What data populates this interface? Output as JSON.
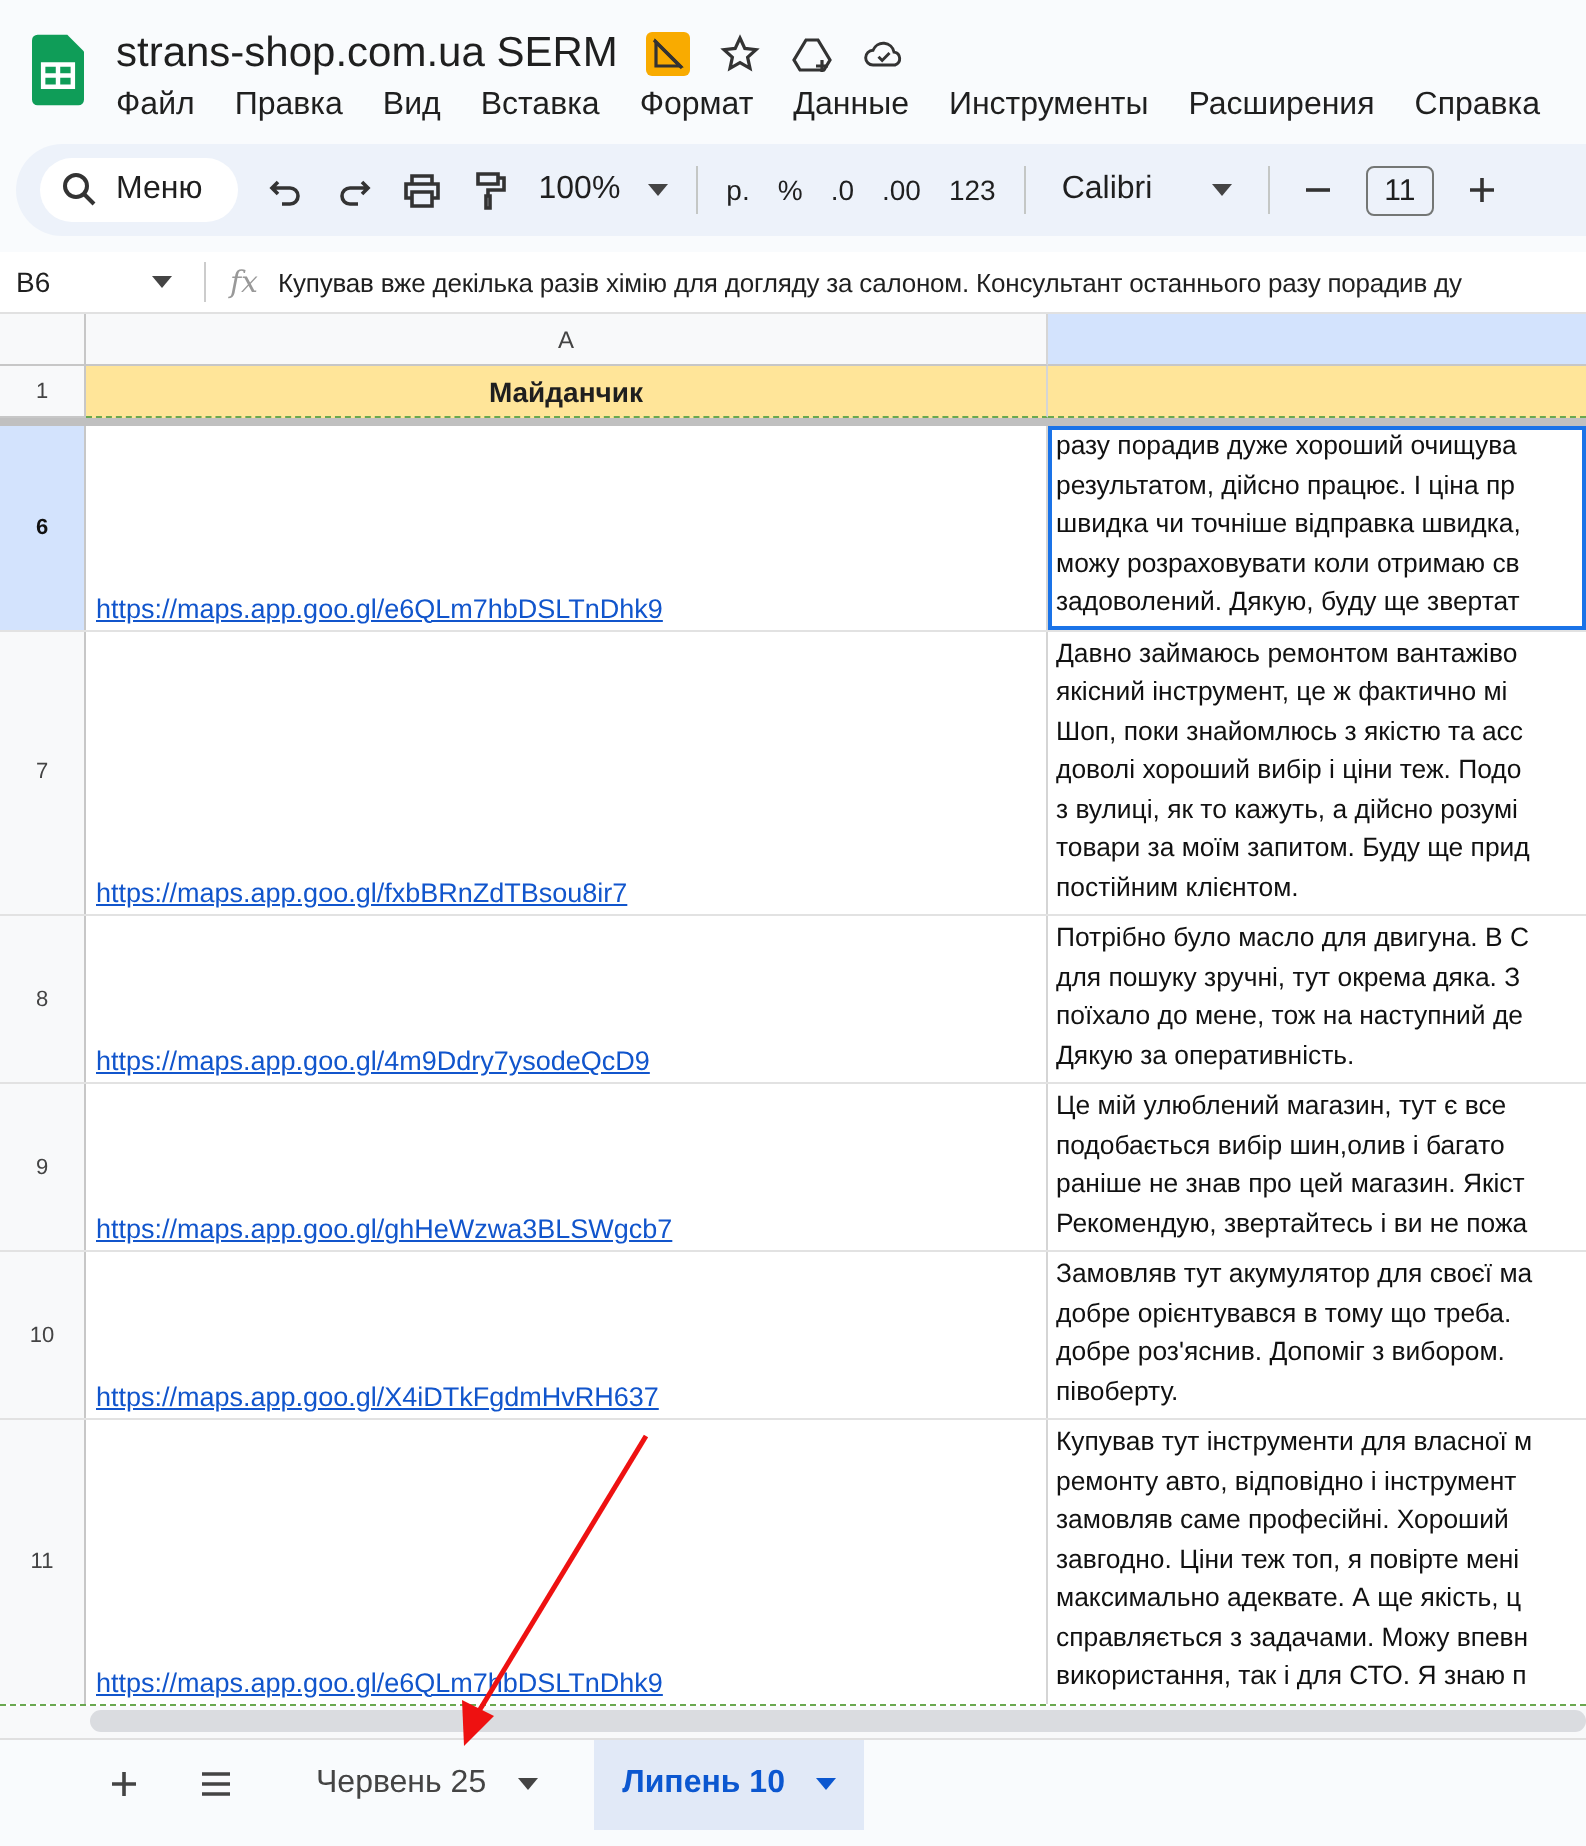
{
  "app": {
    "title": "strans-shop.com.ua SERM",
    "menu": [
      "Файл",
      "Правка",
      "Вид",
      "Вставка",
      "Формат",
      "Данные",
      "Инструменты",
      "Расширения",
      "Справка"
    ]
  },
  "toolbar": {
    "menu_search": "Меню",
    "zoom": "100%",
    "formats": [
      "р.",
      "%",
      ".0",
      ".00",
      "123"
    ],
    "font": "Calibri",
    "font_size": "11"
  },
  "formula_bar": {
    "cell": "B6",
    "function_label": "fx",
    "content": "Купував вже декілька разів хімію для догляду за салоном. Консультант останнього разу порадив ду"
  },
  "columns": [
    {
      "label": "A",
      "selected": false
    },
    {
      "selected": true
    }
  ],
  "header_row": {
    "number": "1",
    "title": "Майданчик"
  },
  "rows": [
    {
      "number": "6",
      "selected": true,
      "link": "https://maps.app.goo.gl/e6QLm7hbDSLTnDhk9",
      "review": [
        "разу порадив дуже хороший очищува",
        "результатом, дійсно працює. І ціна пр",
        "швидка чи точніше відправка швидка,",
        "можу розраховувати коли отримаю св",
        "задоволений. Дякую, буду ще звертат"
      ]
    },
    {
      "number": "7",
      "selected": false,
      "link": "https://maps.app.goo.gl/fxbBRnZdTBsou8ir7",
      "review": [
        "Давно займаюсь ремонтом вантажіво",
        "якісний інструмент, це ж фактично мі",
        "Шоп, поки знайомлюсь з якістю та асс",
        "доволі хороший вибір і ціни теж. Подо",
        "з вулиці, як то кажуть, а дійсно розумі",
        "товари за моїм запитом. Буду ще прид",
        "постійним клієнтом."
      ]
    },
    {
      "number": "8",
      "selected": false,
      "link": "https://maps.app.goo.gl/4m9Ddry7ysodeQcD9",
      "review": [
        "Потрібно було масло для двигуна. В С",
        "для пошуку зручні, тут окрема дяка. З",
        "поїхало до мене, тож на наступний де",
        "Дякую за оперативність."
      ]
    },
    {
      "number": "9",
      "selected": false,
      "link": "https://maps.app.goo.gl/ghHeWzwa3BLSWgcb7",
      "review": [
        "Це мій улюблений магазин, тут є все",
        "подобається вибір шин,олив і багато",
        "раніше не знав про цей магазин. Якіст",
        "Рекомендую, звертайтесь і ви не пожа"
      ]
    },
    {
      "number": "10",
      "selected": false,
      "link": "https://maps.app.goo.gl/X4iDTkFgdmHvRH637",
      "review": [
        "Замовляв тут акумулятор для своєї ма",
        "добре орієнтувався в тому що треба.",
        "добре роз'яснив. Допоміг з вибором.",
        "півоберту."
      ]
    },
    {
      "number": "11",
      "selected": false,
      "link": "https://maps.app.goo.gl/e6QLm7hbDSLTnDhk9",
      "review": [
        "Купував тут інструменти для власної м",
        "ремонту авто, відповідно і інструмент",
        "замовляв саме професійні. Хороший",
        "завгодно. Ціни теж топ, я повірте мені",
        "максимально адеквате. А ще якість, ц",
        "справляється з задачами. Можу впевн",
        "використання, так і для СТО. Я знаю п"
      ]
    }
  ],
  "sheet_tabs": [
    {
      "label": "Червень 25",
      "selected": false
    },
    {
      "label": "Липень 10",
      "selected": true
    }
  ]
}
